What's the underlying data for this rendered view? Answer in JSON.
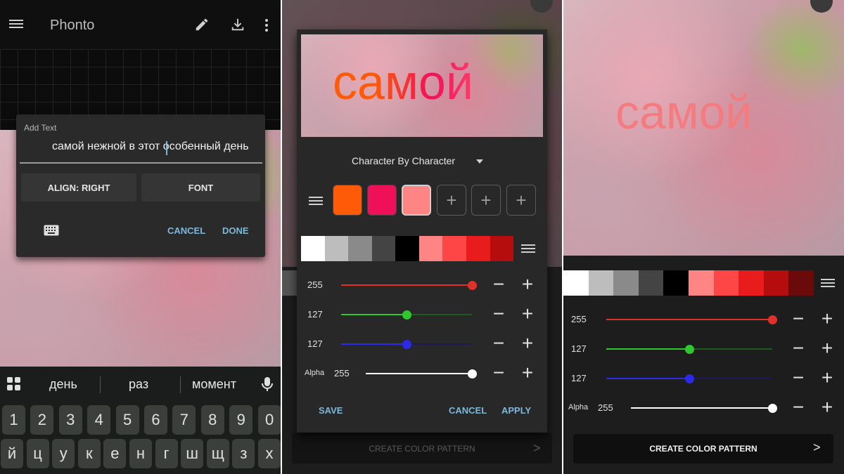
{
  "panel1": {
    "app_title": "Phonto",
    "dialog": {
      "label": "Add Text",
      "input_value": "самой нежной в этот особенный день",
      "align_label": "ALIGN: RIGHT",
      "font_label": "FONT",
      "cancel_label": "CANCEL",
      "done_label": "DONE"
    },
    "keyboard": {
      "suggestions": [
        "день",
        "раз",
        "момент"
      ],
      "number_row": [
        "1",
        "2",
        "3",
        "4",
        "5",
        "6",
        "7",
        "8",
        "9",
        "0"
      ],
      "letter_row": [
        "й",
        "ц",
        "у",
        "к",
        "е",
        "н",
        "г",
        "ш",
        "щ",
        "з",
        "х"
      ]
    }
  },
  "panel2": {
    "preview_text": "самой",
    "mode_select": "Character By Character",
    "colors": [
      "#ff5a08",
      "#f0105a",
      "#ff8585"
    ],
    "palette": [
      "#ffffff",
      "#bdbdbd",
      "#8a8a8a",
      "#444444",
      "#000000",
      "#ff8585",
      "#ff4646",
      "#e81c1c",
      "#b50d0d"
    ],
    "sliders": {
      "red_value": "255",
      "green_value": "127",
      "blue_value": "127",
      "alpha_label": "Alpha",
      "alpha_value": "255",
      "red_level": 1.0,
      "green_level": 0.5,
      "blue_level": 0.5,
      "alpha_level": 1.0
    },
    "save_label": "SAVE",
    "cancel_label": "CANCEL",
    "apply_label": "APPLY",
    "pattern_label": "CREATE COLOR PATTERN"
  },
  "panel3": {
    "preview_text": "самой",
    "palette": [
      "#ffffff",
      "#bdbdbd",
      "#8a8a8a",
      "#444444",
      "#000000",
      "#ff8585",
      "#ff4646",
      "#e81c1c",
      "#b50d0d",
      "#6a0a0a"
    ],
    "sliders": {
      "red_value": "255",
      "green_value": "127",
      "blue_value": "127",
      "alpha_label": "Alpha",
      "alpha_value": "255",
      "red_level": 1.0,
      "green_level": 0.5,
      "blue_level": 0.5,
      "alpha_level": 1.0
    },
    "pattern_label": "CREATE COLOR PATTERN"
  }
}
